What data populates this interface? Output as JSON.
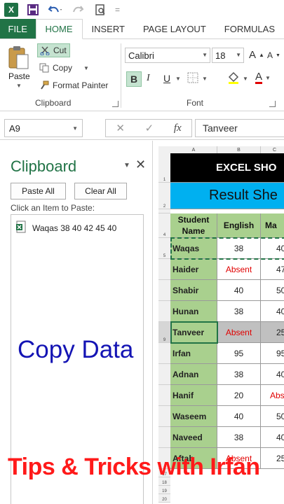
{
  "qat": {
    "app_icon_label": "X",
    "separator": "="
  },
  "tabs": [
    {
      "label": "FILE"
    },
    {
      "label": "HOME"
    },
    {
      "label": "INSERT"
    },
    {
      "label": "PAGE LAYOUT"
    },
    {
      "label": "FORMULAS"
    }
  ],
  "ribbon": {
    "clipboard": {
      "paste_label": "Paste",
      "cut_label": "Cut",
      "copy_label": "Copy",
      "format_painter_label": "Format Painter",
      "group_label": "Clipboard"
    },
    "font": {
      "font_name": "Calibri",
      "font_size": "18",
      "bold_label": "B",
      "italic_label": "I",
      "underline_label": "U",
      "grow_label": "A",
      "shrink_label": "A",
      "font_color_label": "A",
      "group_label": "Font"
    }
  },
  "formula_bar": {
    "name_box": "A9",
    "fx_label": "fx",
    "content": "Tanveer"
  },
  "clipboard_pane": {
    "title": "Clipboard",
    "paste_all_label": "Paste All",
    "clear_all_label": "Clear All",
    "hint": "Click an Item to Paste:",
    "items": [
      "Waqas 38 40 42 45 40"
    ]
  },
  "sheet": {
    "columns": [
      "A",
      "B",
      "C"
    ],
    "title_top": "EXCEL SHO",
    "title_second": "Result She",
    "headers": [
      "Student Name",
      "English",
      "Ma"
    ],
    "rows": [
      {
        "row": "5",
        "name": "Waqas",
        "english": "38",
        "third": "40"
      },
      {
        "row": "",
        "name": "Haider",
        "english": "Absent",
        "third": "47"
      },
      {
        "row": "",
        "name": "Shabir",
        "english": "40",
        "third": "50"
      },
      {
        "row": "",
        "name": "Hunan",
        "english": "38",
        "third": "40"
      },
      {
        "row": "9",
        "name": "Tanveer",
        "english": "Absent",
        "third": "25"
      },
      {
        "row": "",
        "name": "Irfan",
        "english": "95",
        "third": "95"
      },
      {
        "row": "",
        "name": "Adnan",
        "english": "38",
        "third": "40"
      },
      {
        "row": "",
        "name": "Hanif",
        "english": "20",
        "third": "Abs"
      },
      {
        "row": "",
        "name": "Waseem",
        "english": "40",
        "third": "50"
      },
      {
        "row": "",
        "name": "Naveed",
        "english": "38",
        "third": "40"
      },
      {
        "row": "",
        "name": "Aftab",
        "english": "Absent",
        "third": "25"
      }
    ],
    "row_numbers": {
      "title_top": "1",
      "title_second": "2",
      "header": "4"
    },
    "extra_rows": [
      "17",
      "18",
      "19",
      "20"
    ]
  },
  "overlays": {
    "copy_data": "Copy Data",
    "tips": "Tips & Tricks with Irfan"
  },
  "colors": {
    "excel_green": "#217346",
    "title_blue": "#00b0f0",
    "header_green": "#a9d08e",
    "absent_red": "#e00000",
    "overlay_blue": "#1414b4",
    "overlay_red": "#ff1a1a"
  }
}
